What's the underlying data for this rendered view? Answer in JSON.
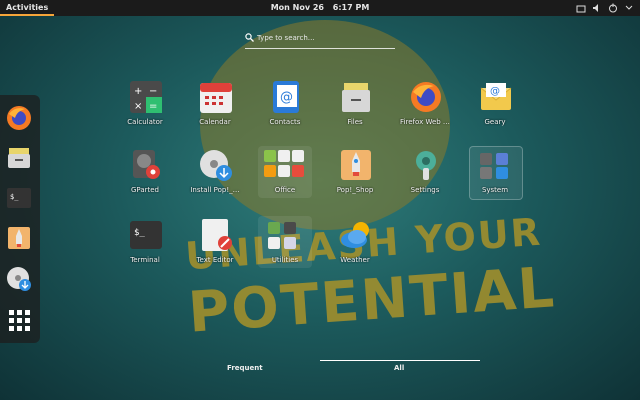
{
  "topbar": {
    "activities": "Activities",
    "date": "Mon Nov 26",
    "time": "6:17 PM"
  },
  "search": {
    "placeholder": "Type to search…"
  },
  "wallpaper": {
    "line1": "UNLEASH YOUR",
    "line2": "POTENTIAL"
  },
  "dock": {
    "items": [
      "firefox-icon",
      "files-icon",
      "terminal-icon",
      "pop-shop-icon",
      "install-pop-icon",
      "show-apps-icon"
    ]
  },
  "apps": [
    {
      "label": "Calculator"
    },
    {
      "label": "Calendar"
    },
    {
      "label": "Contacts"
    },
    {
      "label": "Files"
    },
    {
      "label": "Firefox Web …"
    },
    {
      "label": "Geary"
    },
    {
      "label": "GParted"
    },
    {
      "label": "Install Pop!_…"
    },
    {
      "label": "Office"
    },
    {
      "label": "Pop!_Shop"
    },
    {
      "label": "Settings"
    },
    {
      "label": "System"
    },
    {
      "label": "Terminal"
    },
    {
      "label": "Text Editor"
    },
    {
      "label": "Utilities"
    },
    {
      "label": "Weather"
    }
  ],
  "tabs": {
    "frequent": "Frequent",
    "all": "All"
  },
  "colors": {
    "accent": "#f6a53a",
    "topbar_bg": "#1b1b1b"
  }
}
